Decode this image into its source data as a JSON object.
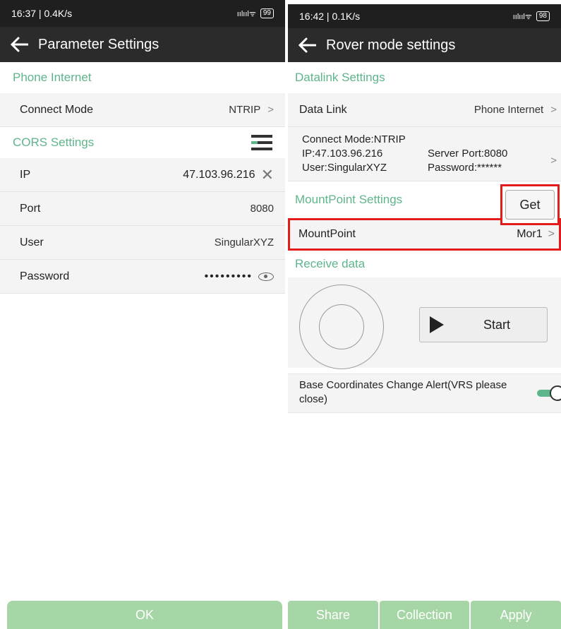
{
  "left": {
    "status": {
      "time": "16:37 | 0.4K/s",
      "signal": "ıılıılᯤ",
      "battery": "99"
    },
    "title": "Parameter Settings",
    "phone_internet_header": "Phone Internet",
    "connect_mode": {
      "label": "Connect Mode",
      "value": "NTRIP",
      "chevron": ">"
    },
    "cors_header": "CORS Settings",
    "fields": {
      "ip": {
        "label": "IP",
        "value": "47.103.96.216",
        "clear": "✕"
      },
      "port": {
        "label": "Port",
        "value": "8080"
      },
      "user": {
        "label": "User",
        "value": "SingularXYZ"
      },
      "password": {
        "label": "Password",
        "value": "•••••••••"
      }
    },
    "ok_label": "OK"
  },
  "right": {
    "status": {
      "time": "16:42 | 0.1K/s",
      "signal": "ıılıılᯤ",
      "battery": "98"
    },
    "title": "Rover mode settings",
    "datalink_header": "Datalink Settings",
    "data_link": {
      "label": "Data Link",
      "value": "Phone Internet",
      "chevron": ">"
    },
    "connection": {
      "mode": "Connect Mode:NTRIP",
      "ip": "IP:47.103.96.216",
      "port": "Server Port:8080",
      "user": "User:SingularXYZ",
      "password": "Password:******",
      "chevron": ">"
    },
    "mountpoint_header": "MountPoint Settings",
    "get_label": "Get",
    "mountpoint": {
      "label": "MountPoint",
      "value": "Mor1",
      "chevron": ">"
    },
    "receive_header": "Receive data",
    "start_label": "Start",
    "alert_label": "Base Coordinates Change Alert(VRS please close)",
    "alert_enabled": true,
    "buttons": {
      "share": "Share",
      "collection": "Collection",
      "apply": "Apply"
    }
  },
  "colors": {
    "accent": "#5fb58b",
    "highlight": "#e21b1b",
    "button": "#a6d6a6",
    "bar": "#2b2b2b"
  }
}
